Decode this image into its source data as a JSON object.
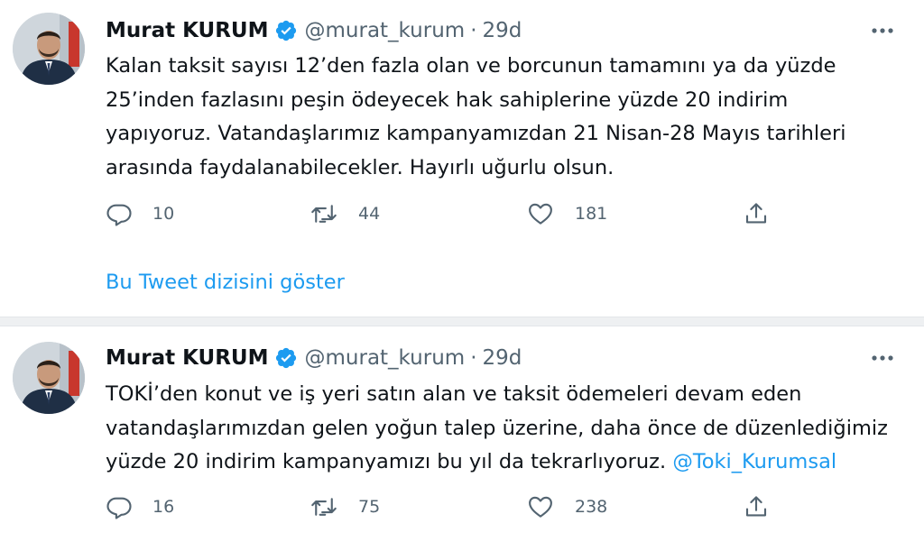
{
  "tweets": [
    {
      "author_name": "Murat KURUM",
      "handle": "@murat_kurum",
      "separator": "·",
      "time": "29d",
      "text_lines": [
        "Kalan taksit sayısı 12’den fazla olan ve borcunun tamamını ya da yüzde",
        "25’inden fazlasını peşin ödeyecek hak sahiplerine yüzde 20 indirim",
        "yapıyoruz. Vatandaşlarımız kampanyamızdan 21 Nisan-28 Mayıs tarihleri",
        "arasında faydalanabilecekler. Hayırlı uğurlu olsun."
      ],
      "replies": "10",
      "retweets": "44",
      "likes": "181",
      "show_thread": "Bu Tweet dizisini göster"
    },
    {
      "author_name": "Murat KURUM",
      "handle": "@murat_kurum",
      "separator": "·",
      "time": "29d",
      "text_lines": [
        "TOKİ’den konut ve iş yeri satın alan ve taksit ödemeleri devam eden",
        "vatandaşlarımızdan gelen yoğun talep üzerine, daha önce de düzenlediğimiz",
        "yüzde 20 indirim kampanyamızı bu yıl da tekrarlıyoruz. "
      ],
      "mention": "@Toki_Kurumsal",
      "replies": "16",
      "retweets": "75",
      "likes": "238"
    }
  ],
  "icons": {
    "verified": "verified-badge-icon",
    "more": "more-options-icon",
    "reply": "reply-icon",
    "retweet": "retweet-icon",
    "like": "heart-icon",
    "share": "share-icon"
  },
  "colors": {
    "accent": "#1d9bf0",
    "text": "#0f1419",
    "muted": "#536471",
    "divider": "#eef0f2"
  }
}
